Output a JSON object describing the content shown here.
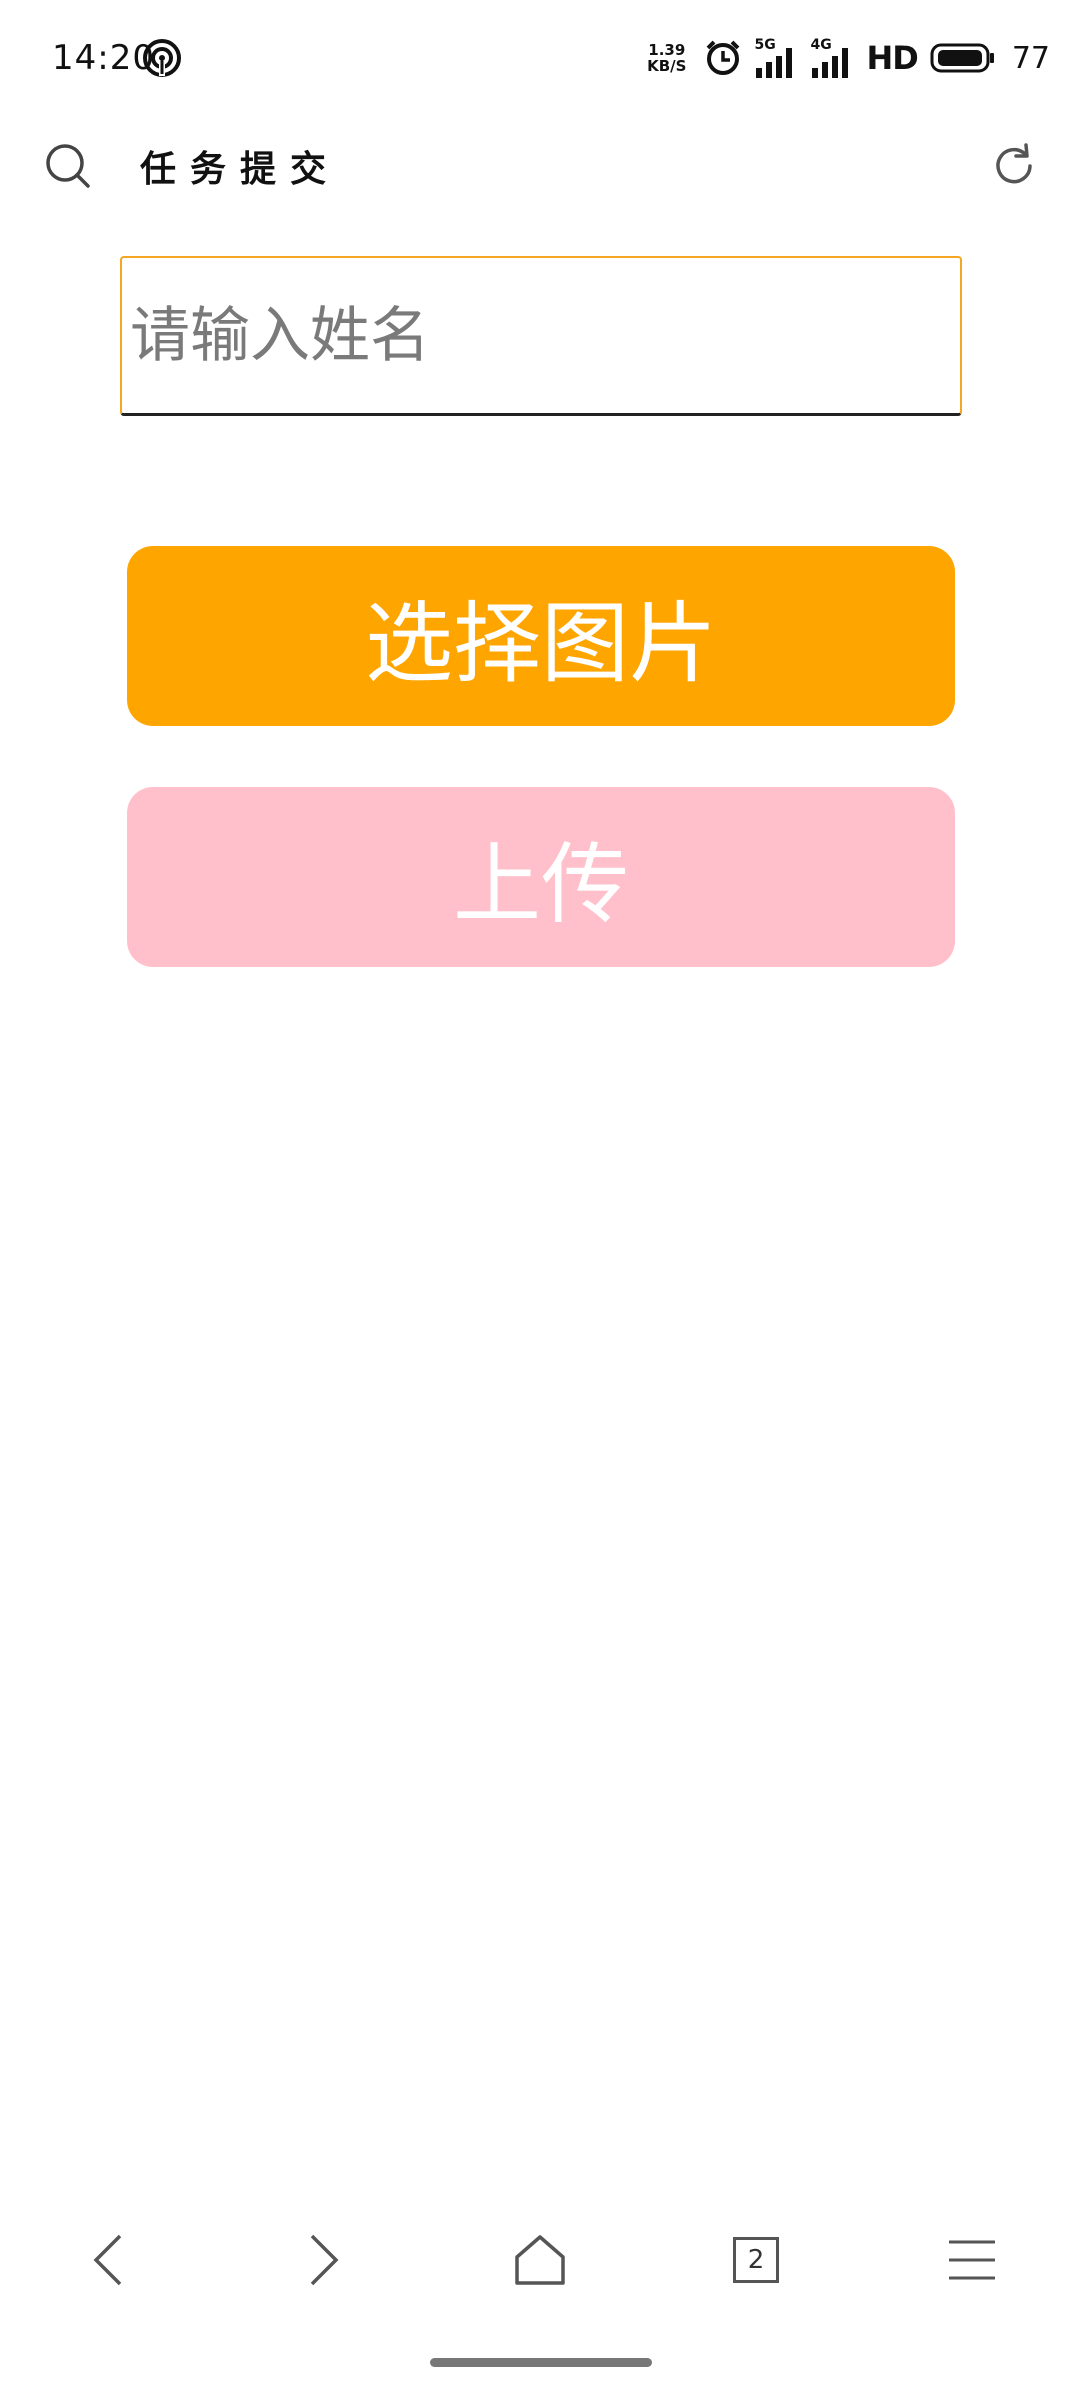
{
  "status_bar": {
    "time": "14:20",
    "net_speed_value": "1.39",
    "net_speed_unit": "KB/S",
    "signal1_label": "5G",
    "signal2_label": "4G",
    "hd_label": "HD",
    "battery_level": "77",
    "icons": [
      "hotspot-icon",
      "alarm-icon",
      "signal-icon",
      "battery-icon"
    ]
  },
  "header": {
    "title": "任务提交",
    "icons": [
      "search-icon",
      "reload-icon"
    ]
  },
  "form": {
    "name_placeholder": "请输入姓名",
    "name_value": "",
    "select_image_label": "选择图片",
    "upload_label": "上传"
  },
  "bottom_nav": {
    "tab_count": "2",
    "icons": [
      "back-icon",
      "forward-icon",
      "home-icon",
      "tabs-icon",
      "menu-icon"
    ]
  },
  "colors": {
    "select_button": "#ffa500",
    "upload_button": "#ffc0cb",
    "input_border": "#f5a623"
  }
}
